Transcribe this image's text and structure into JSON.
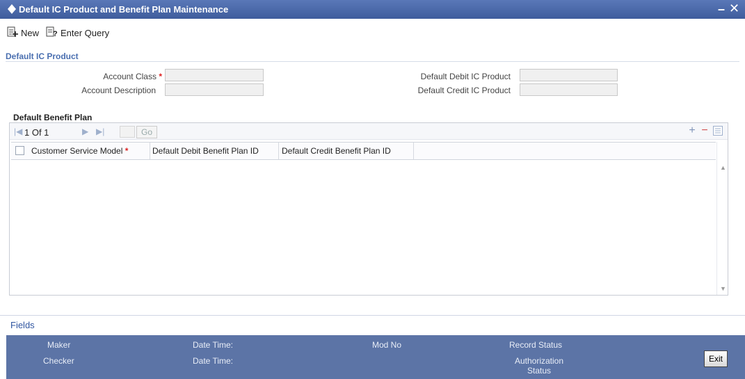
{
  "window": {
    "title": "Default IC Product and Benefit Plan Maintenance",
    "minimize_symbol": "–",
    "close_symbol": "✕"
  },
  "toolbar": {
    "new_label": "New",
    "enter_query_label": "Enter Query"
  },
  "section": {
    "title": "Default IC Product"
  },
  "form": {
    "account_class_label": "Account Class",
    "account_class_value": "",
    "account_description_label": "Account Description",
    "account_description_value": "",
    "default_debit_ic_product_label": "Default Debit IC Product",
    "default_debit_ic_product_value": "",
    "default_credit_ic_product_label": "Default Credit IC Product",
    "default_credit_ic_product_value": "",
    "required_marker": "*"
  },
  "benefit_plan": {
    "title": "Default Benefit Plan",
    "pager": {
      "text": "1 Of 1",
      "page_input": "",
      "go_label": "Go"
    },
    "columns": [
      "Customer Service Model",
      "Default Debit Benefit Plan ID",
      "Default Credit Benefit Plan ID"
    ],
    "rows": []
  },
  "fields_link": "Fields",
  "footer": {
    "maker_label": "Maker",
    "checker_label": "Checker",
    "date_time_label_1": "Date Time:",
    "date_time_label_2": "Date Time:",
    "mod_no_label": "Mod No",
    "record_status_label": "Record Status",
    "authorization_status_label_line1": "Authorization",
    "authorization_status_label_line2": "Status",
    "exit_label": "Exit"
  },
  "colors": {
    "title_bar": "#4a68a8",
    "footer_bar": "#5c74a6",
    "section_title": "#4a6fb0",
    "required": "#dd2222",
    "link": "#2f55a0"
  }
}
